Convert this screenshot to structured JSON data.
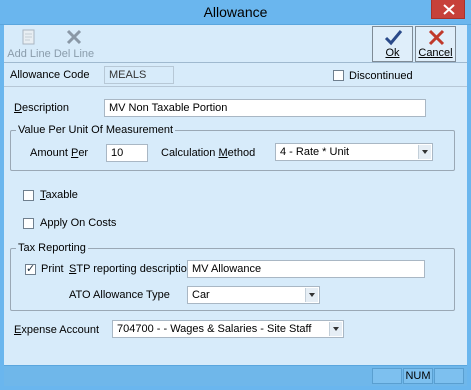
{
  "window": {
    "title": "Allowance"
  },
  "toolbar": {
    "add_line": "Add Line",
    "del_line": "Del Line",
    "ok": "Ok",
    "cancel": "Cancel"
  },
  "header": {
    "allowance_code_label": "Allowance Code",
    "allowance_code_value": "MEALS",
    "discontinued_label": "Discontinued",
    "discontinued_checked": false
  },
  "form": {
    "description_label": "Description",
    "description_value": "MV Non Taxable Portion",
    "value_group_title": "Value Per Unit Of Measurement",
    "amount_per_label": "Amount Per",
    "amount_per_value": "10",
    "calc_method_label": "Calculation Method",
    "calc_method_value": "4 - Rate * Unit",
    "taxable_label": "Taxable",
    "taxable_checked": false,
    "apply_on_costs_label": "Apply On Costs",
    "apply_on_costs_checked": false,
    "tax_group_title": "Tax Reporting",
    "print_label": "Print",
    "print_checked": true,
    "stp_label": "STP reporting description",
    "stp_value": "MV Allowance",
    "ato_label": "ATO Allowance Type",
    "ato_value": "Car",
    "expense_label": "Expense Account",
    "expense_value": "704700 -  - Wages & Salaries - Site Staff"
  },
  "status": {
    "num": "NUM"
  },
  "colors": {
    "titlebar": "#6ab6ee",
    "background": "#d7ebfa",
    "close": "#c7413a",
    "ok_check": "#2a4a8a",
    "cancel_x": "#c0392b"
  }
}
